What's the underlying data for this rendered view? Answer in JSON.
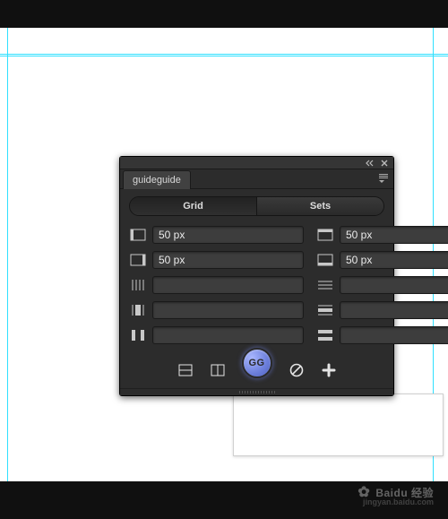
{
  "panel": {
    "title": "guideguide",
    "tabs": {
      "grid": "Grid",
      "sets": "Sets",
      "active": "grid"
    },
    "fields": {
      "left": {
        "value": "50 px"
      },
      "right": {
        "value": "50 px"
      },
      "top": {
        "value": "50 px"
      },
      "bottom": {
        "value": "50 px"
      },
      "cols": {
        "value": ""
      },
      "col_width": {
        "value": ""
      },
      "col_gutter": {
        "value": ""
      },
      "rows": {
        "value": ""
      },
      "row_height": {
        "value": ""
      },
      "row_gutter": {
        "value": ""
      }
    },
    "gg_label": "GG"
  },
  "watermark": {
    "brand": "Baidu 经验"
  }
}
